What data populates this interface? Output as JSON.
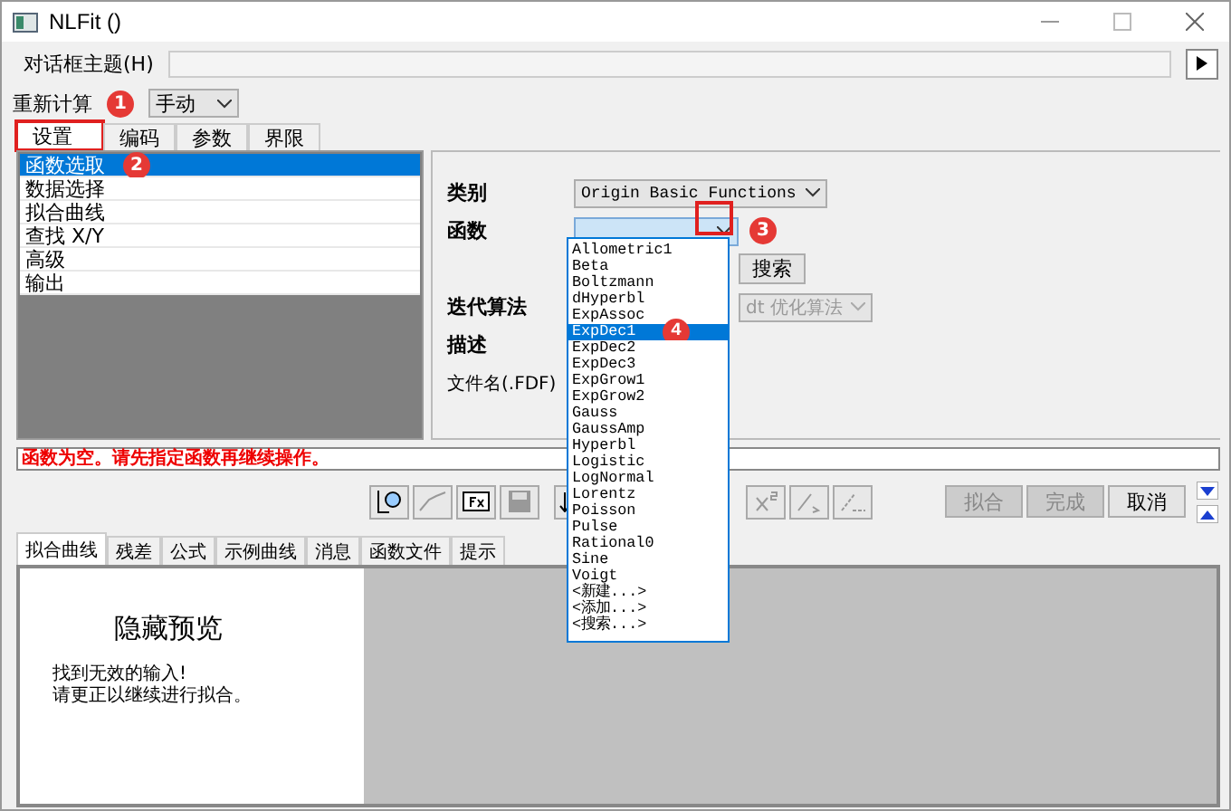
{
  "window": {
    "title": "NLFit ()"
  },
  "dialog_theme": {
    "label": "对话框主题(H)"
  },
  "recalculate": {
    "label": "重新计算",
    "value": "手动"
  },
  "tabs": [
    {
      "label": "设置",
      "selected": true
    },
    {
      "label": "编码",
      "selected": false
    },
    {
      "label": "参数",
      "selected": false
    },
    {
      "label": "界限",
      "selected": false
    }
  ],
  "nav_items": [
    {
      "label": "函数选取",
      "selected": true
    },
    {
      "label": "数据选择",
      "selected": false
    },
    {
      "label": "拟合曲线",
      "selected": false
    },
    {
      "label": "查找 X/Y",
      "selected": false
    },
    {
      "label": "高级",
      "selected": false
    },
    {
      "label": "输出",
      "selected": false
    }
  ],
  "settings": {
    "category": {
      "label": "类别",
      "value": "Origin Basic Functions"
    },
    "function": {
      "label": "函数"
    },
    "search_button": "搜索",
    "iteration": {
      "label": "迭代算法",
      "value": "dt 优化算法",
      "disabled": true
    },
    "description": {
      "label": "描述"
    },
    "file_name": {
      "label": "文件名(.FDF)"
    }
  },
  "function_list": [
    {
      "label": "Allometric1",
      "selected": false
    },
    {
      "label": "Beta",
      "selected": false
    },
    {
      "label": "Boltzmann",
      "selected": false
    },
    {
      "label": "dHyperbl",
      "selected": false
    },
    {
      "label": "ExpAssoc",
      "selected": false
    },
    {
      "label": "ExpDec1",
      "selected": true
    },
    {
      "label": "ExpDec2",
      "selected": false
    },
    {
      "label": "ExpDec3",
      "selected": false
    },
    {
      "label": "ExpGrow1",
      "selected": false
    },
    {
      "label": "ExpGrow2",
      "selected": false
    },
    {
      "label": "Gauss",
      "selected": false
    },
    {
      "label": "GaussAmp",
      "selected": false
    },
    {
      "label": "Hyperbl",
      "selected": false
    },
    {
      "label": "Logistic",
      "selected": false
    },
    {
      "label": "LogNormal",
      "selected": false
    },
    {
      "label": "Lorentz",
      "selected": false
    },
    {
      "label": "Poisson",
      "selected": false
    },
    {
      "label": "Pulse",
      "selected": false
    },
    {
      "label": "Rational0",
      "selected": false
    },
    {
      "label": "Sine",
      "selected": false
    },
    {
      "label": "Voigt",
      "selected": false
    },
    {
      "label": "<新建...>",
      "selected": false
    },
    {
      "label": "<添加...>",
      "selected": false
    },
    {
      "label": "<搜索...>",
      "selected": false
    }
  ],
  "error_message": "函数为空。请先指定函数再继续操作。",
  "action_buttons": [
    {
      "label": "拟合",
      "disabled": true
    },
    {
      "label": "完成",
      "disabled": true
    },
    {
      "label": "取消",
      "disabled": false
    }
  ],
  "preview_tabs": [
    {
      "label": "拟合曲线",
      "selected": true
    },
    {
      "label": "残差",
      "selected": false
    },
    {
      "label": "公式",
      "selected": false
    },
    {
      "label": "示例曲线",
      "selected": false
    },
    {
      "label": "消息",
      "selected": false
    },
    {
      "label": "函数文件",
      "selected": false
    },
    {
      "label": "提示",
      "selected": false
    }
  ],
  "preview": {
    "title": "隐藏预览",
    "lines": [
      "找到无效的输入!",
      "请更正以继续进行拟合。"
    ]
  },
  "annotations": [
    {
      "label": "1"
    },
    {
      "label": "2"
    },
    {
      "label": "3"
    },
    {
      "label": "4"
    }
  ]
}
